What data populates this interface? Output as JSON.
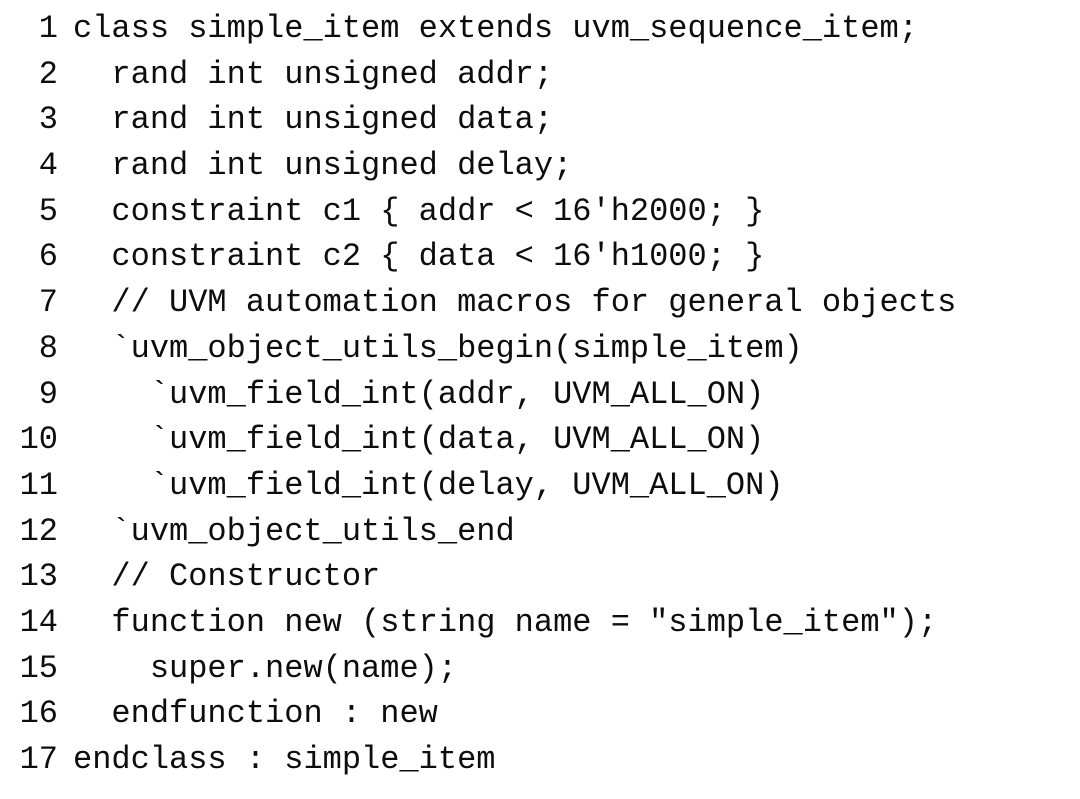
{
  "document": {
    "kind": "source-code-listing",
    "language": "SystemVerilog",
    "class_name": "simple_item",
    "background_color": "#ffffff",
    "text_color": "#0d0d0d",
    "line_count": 17
  },
  "code": {
    "lines": [
      {
        "number": "1",
        "text": "class simple_item extends uvm_sequence_item;"
      },
      {
        "number": "2",
        "text": "  rand int unsigned addr;"
      },
      {
        "number": "3",
        "text": "  rand int unsigned data;"
      },
      {
        "number": "4",
        "text": "  rand int unsigned delay;"
      },
      {
        "number": "5",
        "text": "  constraint c1 { addr < 16'h2000; }"
      },
      {
        "number": "6",
        "text": "  constraint c2 { data < 16'h1000; }"
      },
      {
        "number": "7",
        "text": "  // UVM automation macros for general objects"
      },
      {
        "number": "8",
        "text": "  `uvm_object_utils_begin(simple_item)"
      },
      {
        "number": "9",
        "text": "    `uvm_field_int(addr, UVM_ALL_ON)"
      },
      {
        "number": "10",
        "text": "    `uvm_field_int(data, UVM_ALL_ON)"
      },
      {
        "number": "11",
        "text": "    `uvm_field_int(delay, UVM_ALL_ON)"
      },
      {
        "number": "12",
        "text": "  `uvm_object_utils_end"
      },
      {
        "number": "13",
        "text": "  // Constructor"
      },
      {
        "number": "14",
        "text": "  function new (string name = \"simple_item\");"
      },
      {
        "number": "15",
        "text": "    super.new(name);"
      },
      {
        "number": "16",
        "text": "  endfunction : new"
      },
      {
        "number": "17",
        "text": "endclass : simple_item"
      }
    ]
  }
}
